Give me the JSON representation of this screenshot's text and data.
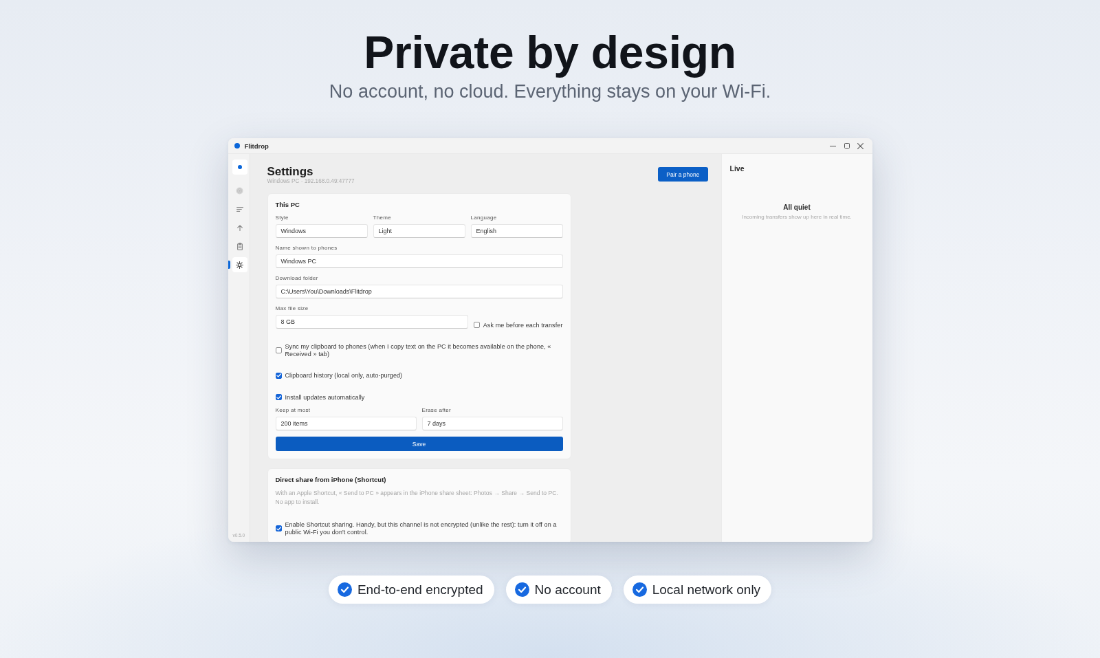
{
  "hero": {
    "title": "Private by design",
    "subtitle": "No account, no cloud. Everything stays on your Wi-Fi."
  },
  "window": {
    "title": "Flitdrop",
    "nav_items": [
      {
        "selected": false
      },
      {
        "selected": false
      },
      {
        "selected": false
      },
      {
        "selected": false
      },
      {
        "selected": true
      }
    ],
    "version": "v0.5.0"
  },
  "header": {
    "title": "Settings",
    "subtitle": "Windows PC · 192.168.0.49:47777",
    "button": "Pair a phone"
  },
  "cards": [
    {
      "title": "This PC",
      "rows": [
        {
          "kind": "fields",
          "fields": [
            {
              "label": "Style",
              "value": "Windows"
            },
            {
              "label": "Theme",
              "value": "Light"
            },
            {
              "label": "Language",
              "value": "English"
            }
          ]
        },
        {
          "kind": "fields",
          "fields": [
            {
              "label": "Name shown to phones",
              "value": "Windows PC"
            }
          ]
        },
        {
          "kind": "fields",
          "fields": [
            {
              "label": "Download folder",
              "value": "C:\\Users\\You\\Downloads\\Flitdrop"
            }
          ]
        },
        {
          "kind": "field_check",
          "field": {
            "label": "Max file size",
            "value": "8 GB"
          },
          "checkbox": {
            "label": "Ask me before each transfer",
            "checked": false
          }
        },
        {
          "kind": "checkbox",
          "label": "Sync my clipboard to phones (when I copy text on the PC it becomes available on the phone, « Received » tab)",
          "checked": false
        },
        {
          "kind": "checkbox",
          "label": "Clipboard history (local only, auto-purged)",
          "checked": true
        },
        {
          "kind": "checkbox",
          "label": "Install updates automatically",
          "checked": true
        },
        {
          "kind": "fields",
          "fields": [
            {
              "label": "Keep at most",
              "value": "200 items"
            },
            {
              "label": "Erase after",
              "value": "7 days"
            }
          ]
        },
        {
          "kind": "button",
          "label": "Save"
        }
      ]
    },
    {
      "title": "Direct share from iPhone (Shortcut)",
      "rows": [
        {
          "kind": "text",
          "text": "With an Apple Shortcut, « Send to PC » appears in the iPhone share sheet: Photos → Share → Send to PC. No app to install."
        },
        {
          "kind": "checkbox",
          "label": "Enable Shortcut sharing. Handy, but this channel is not encrypted (unlike the rest): turn it off on a public Wi-Fi you don't control.",
          "checked": true
        }
      ]
    }
  ],
  "live_panel": {
    "title": "Live",
    "empty_title": "All quiet",
    "empty_text": "Incoming transfers show up here in real time."
  },
  "badges": [
    {
      "label": "End-to-end encrypted"
    },
    {
      "label": "No account"
    },
    {
      "label": "Local network only"
    }
  ]
}
